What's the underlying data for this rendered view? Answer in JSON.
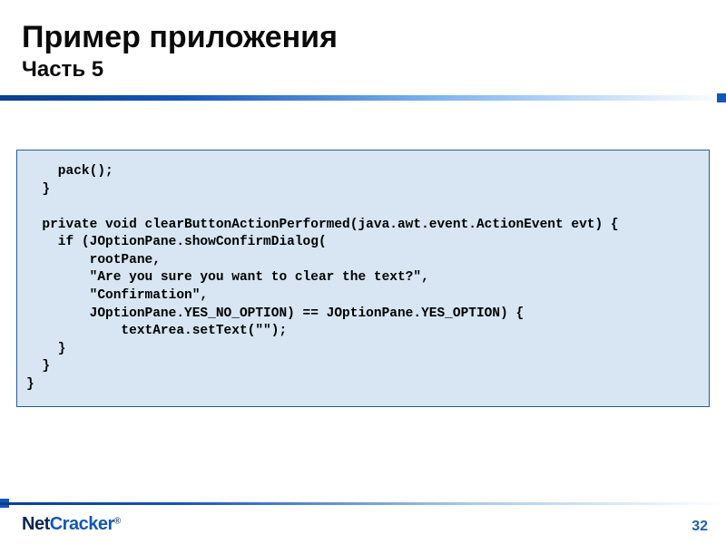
{
  "slide": {
    "title": "Пример приложения",
    "subtitle": "Часть 5",
    "code": "    pack();\n  }\n\n  private void clearButtonActionPerformed(java.awt.event.ActionEvent evt) {\n    if (JOptionPane.showConfirmDialog(\n        rootPane,\n        \"Are you sure you want to clear the text?\",\n        \"Confirmation\",\n        JOptionPane.YES_NO_OPTION) == JOptionPane.YES_OPTION) {\n            textArea.setText(\"\");\n    }\n  }\n}",
    "footer": {
      "logo_net": "Net",
      "logo_cracker": "Cracker",
      "reg": "®",
      "page_number": "32"
    }
  }
}
